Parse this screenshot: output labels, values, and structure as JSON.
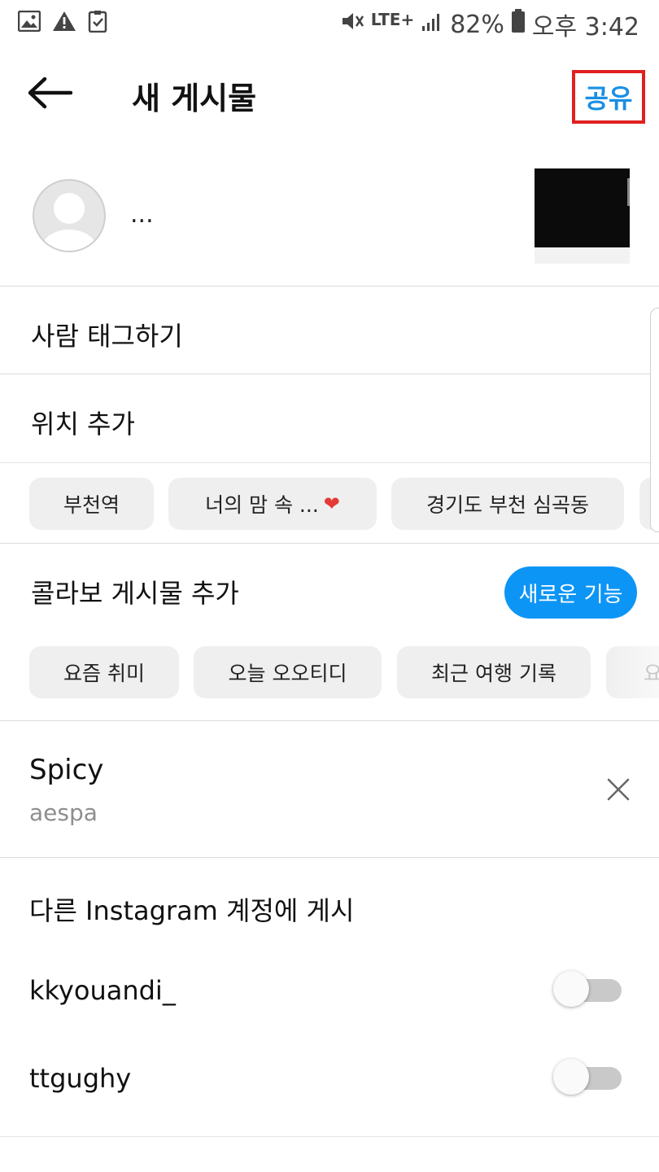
{
  "status_bar": {
    "battery": "82%",
    "time": "오후 3:42",
    "network": "LTE+",
    "icons": [
      "gallery-icon",
      "warning-icon",
      "clipboard-check-icon",
      "mute-icon",
      "signal-icon",
      "battery-icon"
    ]
  },
  "header": {
    "title": "새 게시물",
    "share_label": "공유",
    "back_icon": "arrow-left-icon"
  },
  "post": {
    "caption_placeholder": "...",
    "avatar_icon": "default-avatar-icon"
  },
  "options": {
    "tag_people": "사람 태그하기",
    "add_location": "위치 추가"
  },
  "location_chips": [
    {
      "label": "부천역"
    },
    {
      "label": "너의 맘 속 ...",
      "emoji": "❤️"
    },
    {
      "label": "경기도 부천 심곡동"
    }
  ],
  "collab": {
    "label": "콜라보 게시물 추가",
    "badge": "새로운 기능"
  },
  "topic_chips": [
    {
      "label": "요즘 취미"
    },
    {
      "label": "오늘 오오티디"
    },
    {
      "label": "최근 여행 기록"
    },
    {
      "label": "요"
    }
  ],
  "music": {
    "title": "Spicy",
    "artist": "aespa"
  },
  "cross_post": {
    "title": "다른 Instagram 계정에 게시",
    "accounts": [
      {
        "name": "kkyouandi_",
        "enabled": false
      },
      {
        "name": "ttgughy",
        "enabled": false
      }
    ]
  },
  "colors": {
    "accent": "#0d95f6",
    "share_text": "#1a8fe3",
    "highlight_border": "#e02020",
    "chip_bg": "#efefef",
    "divider": "#dbdbdb"
  }
}
